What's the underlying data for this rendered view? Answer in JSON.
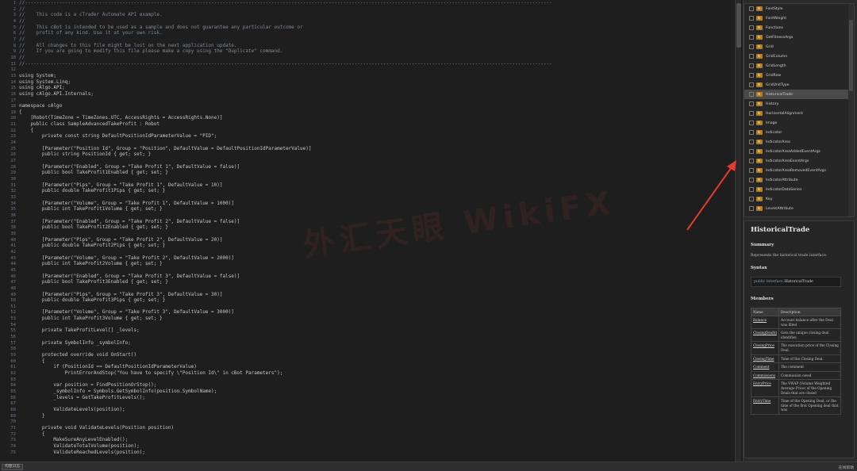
{
  "editor": {
    "lines": [
      {
        "n": "1",
        "t": "//----------------------------------------------------------------------------------------------------------------------------------------------------------------------------------------",
        "c": "cm"
      },
      {
        "n": "2",
        "t": "//",
        "c": "cm"
      },
      {
        "n": "3",
        "t": "//    This code is a cTrader Automate API example.",
        "c": "cm"
      },
      {
        "n": "4",
        "t": "//",
        "c": "cm"
      },
      {
        "n": "5",
        "t": "//    This cBot is intended to be used as a sample and does not guarantee any particular outcome or",
        "c": "cm"
      },
      {
        "n": "6",
        "t": "//    profit of any kind. Use it at your own risk.",
        "c": "cm"
      },
      {
        "n": "7",
        "t": "//",
        "c": "cm"
      },
      {
        "n": "8",
        "t": "//    All changes to this file might be lost on the next application update.",
        "c": "cm"
      },
      {
        "n": "9",
        "t": "//    If you are going to modify this file please make a copy using the \"Duplicate\" command.",
        "c": "cm"
      },
      {
        "n": "10",
        "t": "//",
        "c": "cm"
      },
      {
        "n": "11",
        "t": "//----------------------------------------------------------------------------------------------------------------------------------------------------------------------------------------",
        "c": "cm"
      },
      {
        "n": "12",
        "t": "",
        "c": ""
      },
      {
        "n": "13",
        "t": "using System;",
        "c": ""
      },
      {
        "n": "14",
        "t": "using System.Linq;",
        "c": ""
      },
      {
        "n": "15",
        "t": "using cAlgo.API;",
        "c": ""
      },
      {
        "n": "16",
        "t": "using cAlgo.API.Internals;",
        "c": ""
      },
      {
        "n": "17",
        "t": "",
        "c": ""
      },
      {
        "n": "18",
        "t": "namespace cAlgo",
        "c": ""
      },
      {
        "n": "19",
        "t": "{",
        "c": ""
      },
      {
        "n": "20",
        "t": "    [Robot(TimeZone = TimeZones.UTC, AccessRights = AccessRights.None)]",
        "c": ""
      },
      {
        "n": "21",
        "t": "    public class SampleAdvancedTakeProfit : Robot",
        "c": ""
      },
      {
        "n": "22",
        "t": "    {",
        "c": ""
      },
      {
        "n": "23",
        "t": "        private const string DefaultPositionIdParameterValue = \"PID\";",
        "c": ""
      },
      {
        "n": "24",
        "t": "",
        "c": ""
      },
      {
        "n": "25",
        "t": "        [Parameter(\"Position Id\", Group = \"Position\", DefaultValue = DefaultPositionIdParameterValue)]",
        "c": ""
      },
      {
        "n": "26",
        "t": "        public string PositionId { get; set; }",
        "c": ""
      },
      {
        "n": "27",
        "t": "",
        "c": ""
      },
      {
        "n": "28",
        "t": "        [Parameter(\"Enabled\", Group = \"Take Profit 1\", DefaultValue = false)]",
        "c": ""
      },
      {
        "n": "29",
        "t": "        public bool TakeProfit1Enabled { get; set; }",
        "c": ""
      },
      {
        "n": "30",
        "t": "",
        "c": ""
      },
      {
        "n": "31",
        "t": "        [Parameter(\"Pips\", Group = \"Take Profit 1\", DefaultValue = 10)]",
        "c": ""
      },
      {
        "n": "32",
        "t": "        public double TakeProfit1Pips { get; set; }",
        "c": ""
      },
      {
        "n": "33",
        "t": "",
        "c": ""
      },
      {
        "n": "34",
        "t": "        [Parameter(\"Volume\", Group = \"Take Profit 1\", DefaultValue = 1000)]",
        "c": ""
      },
      {
        "n": "35",
        "t": "        public int TakeProfit1Volume { get; set; }",
        "c": ""
      },
      {
        "n": "36",
        "t": "",
        "c": ""
      },
      {
        "n": "37",
        "t": "        [Parameter(\"Enabled\", Group = \"Take Profit 2\", DefaultValue = false)]",
        "c": ""
      },
      {
        "n": "38",
        "t": "        public bool TakeProfit2Enabled { get; set; }",
        "c": ""
      },
      {
        "n": "39",
        "t": "",
        "c": ""
      },
      {
        "n": "40",
        "t": "        [Parameter(\"Pips\", Group = \"Take Profit 2\", DefaultValue = 20)]",
        "c": ""
      },
      {
        "n": "41",
        "t": "        public double TakeProfit2Pips { get; set; }",
        "c": ""
      },
      {
        "n": "42",
        "t": "",
        "c": ""
      },
      {
        "n": "43",
        "t": "        [Parameter(\"Volume\", Group = \"Take Profit 2\", DefaultValue = 2000)]",
        "c": ""
      },
      {
        "n": "44",
        "t": "        public int TakeProfit2Volume { get; set; }",
        "c": ""
      },
      {
        "n": "45",
        "t": "",
        "c": ""
      },
      {
        "n": "46",
        "t": "        [Parameter(\"Enabled\", Group = \"Take Profit 3\", DefaultValue = false)]",
        "c": ""
      },
      {
        "n": "47",
        "t": "        public bool TakeProfit3Enabled { get; set; }",
        "c": ""
      },
      {
        "n": "48",
        "t": "",
        "c": ""
      },
      {
        "n": "49",
        "t": "        [Parameter(\"Pips\", Group = \"Take Profit 3\", DefaultValue = 30)]",
        "c": ""
      },
      {
        "n": "50",
        "t": "        public double TakeProfit3Pips { get; set; }",
        "c": ""
      },
      {
        "n": "51",
        "t": "",
        "c": ""
      },
      {
        "n": "52",
        "t": "        [Parameter(\"Volume\", Group = \"Take Profit 3\", DefaultValue = 3000)]",
        "c": ""
      },
      {
        "n": "53",
        "t": "        public int TakeProfit3Volume { get; set; }",
        "c": ""
      },
      {
        "n": "54",
        "t": "",
        "c": ""
      },
      {
        "n": "55",
        "t": "        private TakeProfitLevel[] _levels;",
        "c": ""
      },
      {
        "n": "56",
        "t": "",
        "c": ""
      },
      {
        "n": "57",
        "t": "        private SymbolInfo _symbolInfo;",
        "c": ""
      },
      {
        "n": "58",
        "t": "",
        "c": ""
      },
      {
        "n": "59",
        "t": "        protected override void OnStart()",
        "c": ""
      },
      {
        "n": "60",
        "t": "        {",
        "c": ""
      },
      {
        "n": "61",
        "t": "            if (PositionId == DefaultPositionIdParameterValue)",
        "c": ""
      },
      {
        "n": "62",
        "t": "                PrintErrorAndStop(\"You have to specify \\\"Position Id\\\" in cBot Parameters\");",
        "c": ""
      },
      {
        "n": "63",
        "t": "",
        "c": ""
      },
      {
        "n": "64",
        "t": "            var position = FindPositionOrStop();",
        "c": ""
      },
      {
        "n": "65",
        "t": "            _symbolInfo = Symbols.GetSymbolInfo(position.SymbolName);",
        "c": ""
      },
      {
        "n": "66",
        "t": "            _levels = GetTakeProfitLevels();",
        "c": ""
      },
      {
        "n": "67",
        "t": "",
        "c": ""
      },
      {
        "n": "68",
        "t": "            ValidateLevels(position);",
        "c": ""
      },
      {
        "n": "69",
        "t": "        }",
        "c": ""
      },
      {
        "n": "70",
        "t": "",
        "c": ""
      },
      {
        "n": "71",
        "t": "        private void ValidateLevels(Position position)",
        "c": ""
      },
      {
        "n": "72",
        "t": "        {",
        "c": ""
      },
      {
        "n": "73",
        "t": "            MakeSureAnyLevelEnabled();",
        "c": ""
      },
      {
        "n": "74",
        "t": "            ValidateTotalVolume(position);",
        "c": ""
      },
      {
        "n": "75",
        "t": "            ValidateReachedLevels(position);",
        "c": ""
      }
    ]
  },
  "tree": {
    "items": [
      {
        "label": "FontStyle"
      },
      {
        "label": "FontWeight"
      },
      {
        "label": "Functions"
      },
      {
        "label": "GetFitnessArgs"
      },
      {
        "label": "Grid"
      },
      {
        "label": "GridColumn"
      },
      {
        "label": "GridLength"
      },
      {
        "label": "GridRow"
      },
      {
        "label": "GridUnitType"
      },
      {
        "label": "HistoricalTrade"
      },
      {
        "label": "History"
      },
      {
        "label": "HorizontalAlignment"
      },
      {
        "label": "Image"
      },
      {
        "label": "Indicator"
      },
      {
        "label": "IndicatorArea"
      },
      {
        "label": "IndicatorAreaAddedEventArgs"
      },
      {
        "label": "IndicatorAreaEventArgs"
      },
      {
        "label": "IndicatorAreaRemovedEventArgs"
      },
      {
        "label": "IndicatorAttribute"
      },
      {
        "label": "IndicatorDataSeries"
      },
      {
        "label": "Key"
      },
      {
        "label": "LevelsAttribute"
      }
    ],
    "selected_label": "HistoricalTrade"
  },
  "doc": {
    "title": "HistoricalTrade",
    "summary_heading": "Summary",
    "summary_text": "Represents the historical trade interface.",
    "syntax_heading": "Syntax",
    "syntax_keywords": "public interface",
    "syntax_name": "HistoricalTrade",
    "members_heading": "Members",
    "table_headers": [
      "Name",
      "Description"
    ],
    "members": [
      {
        "name": "Balance",
        "desc": "Account balance after the Deal was filled"
      },
      {
        "name": "ClosingDealId",
        "desc": "Gets the unique closing deal identifier."
      },
      {
        "name": "ClosingPrice",
        "desc": "The execution price of the Closing Deal."
      },
      {
        "name": "ClosingTime",
        "desc": "Time of the Closing Deal."
      },
      {
        "name": "Comment",
        "desc": "The comment"
      },
      {
        "name": "Commissions",
        "desc": "Commission owed"
      },
      {
        "name": "EntryPrice",
        "desc": "The VWAP (Volume Weighted Average Price) of the Opening Deals that are closed"
      },
      {
        "name": "EntryTime",
        "desc": "Time of the Opening Deal, or the time of the first Opening deal that was"
      }
    ]
  },
  "status": {
    "left_label": "构建日志",
    "right_label": "在线帮助"
  },
  "watermark": {
    "text": "外汇天眼 WikiFX"
  },
  "colors": {
    "editor_bg": "#1e1e1e",
    "panel_bg": "#262626",
    "annotation_arrow": "#e83a2e",
    "keyword": "#569cd6"
  }
}
